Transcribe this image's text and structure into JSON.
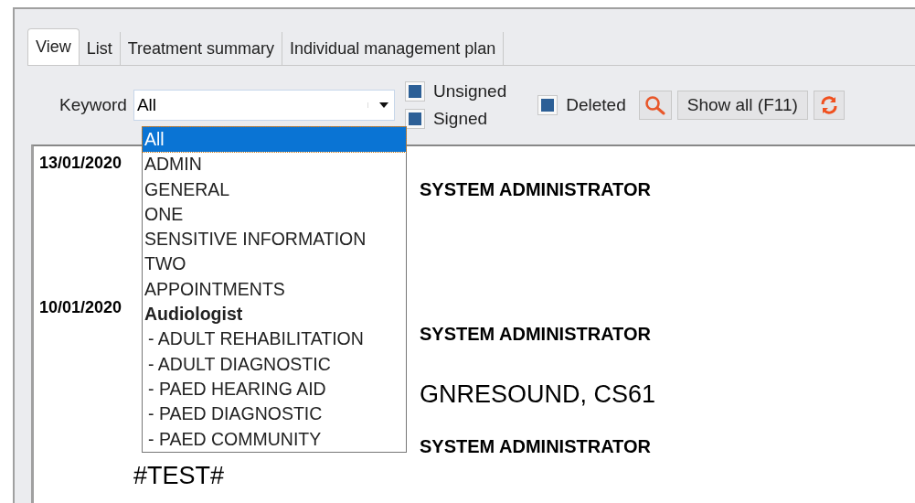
{
  "tabs": [
    {
      "label": "View",
      "selected": true
    },
    {
      "label": "List",
      "selected": false
    },
    {
      "label": "Treatment summary",
      "selected": false
    },
    {
      "label": "Individual management plan",
      "selected": false
    }
  ],
  "filter": {
    "label": "Keyword",
    "value": "All"
  },
  "checkboxes": [
    {
      "label": "Unsigned",
      "checked": true
    },
    {
      "label": "Signed",
      "checked": true
    },
    {
      "label": "Deleted",
      "checked": true
    }
  ],
  "show_all_button": "Show all (F11)",
  "dropdown": [
    {
      "label": "All",
      "kind": "option",
      "selected": true
    },
    {
      "label": "ADMIN",
      "kind": "option",
      "selected": false
    },
    {
      "label": "GENERAL",
      "kind": "option",
      "selected": false
    },
    {
      "label": "ONE",
      "kind": "option",
      "selected": false
    },
    {
      "label": "SENSITIVE INFORMATION",
      "kind": "option",
      "selected": false
    },
    {
      "label": "TWO",
      "kind": "option",
      "selected": false
    },
    {
      "label": "APPOINTMENTS",
      "kind": "option",
      "selected": false
    },
    {
      "label": "Audiologist",
      "kind": "group",
      "selected": false
    },
    {
      "label": "- ADULT REHABILITATION",
      "kind": "sub",
      "selected": false
    },
    {
      "label": "- ADULT DIAGNOSTIC",
      "kind": "sub",
      "selected": false
    },
    {
      "label": "- PAED HEARING AID",
      "kind": "sub",
      "selected": false
    },
    {
      "label": "- PAED DIAGNOSTIC",
      "kind": "sub",
      "selected": false
    },
    {
      "label": "- PAED COMMUNITY",
      "kind": "sub",
      "selected": false
    }
  ],
  "entries": [
    {
      "date": "13/01/2020",
      "author": "SYSTEM ADMINISTRATOR"
    },
    {
      "date": "10/01/2020",
      "author": "SYSTEM ADMINISTRATOR",
      "detail": "GNRESOUND, CS61"
    },
    {
      "author": "SYSTEM ADMINISTRATOR",
      "note": "#TEST#"
    }
  ]
}
